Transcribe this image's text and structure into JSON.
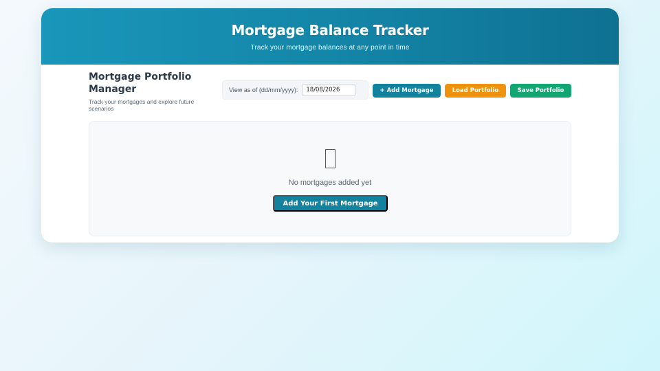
{
  "header": {
    "title": "Mortgage Balance Tracker",
    "subtitle": "Track your mortgage balances at any point in time"
  },
  "manager": {
    "title": "Mortgage Portfolio Manager",
    "description": "Track your mortgages and explore future scenarios"
  },
  "view_date": {
    "label": "View as of (dd/mm/yyyy):",
    "value": "18/08/2026"
  },
  "actions": {
    "add_label": "+ Add Mortgage",
    "load_label": "Load Portfolio",
    "save_label": "Save Portfolio"
  },
  "empty_state": {
    "icon": "house-icon",
    "message": "No mortgages added yet",
    "cta_label": "Add Your First Mortgage"
  },
  "colors": {
    "header_gradient_start": "#1996ba",
    "header_gradient_end": "#0e7192",
    "primary": "#12829e",
    "load": "#ef920d",
    "save": "#13a572"
  }
}
